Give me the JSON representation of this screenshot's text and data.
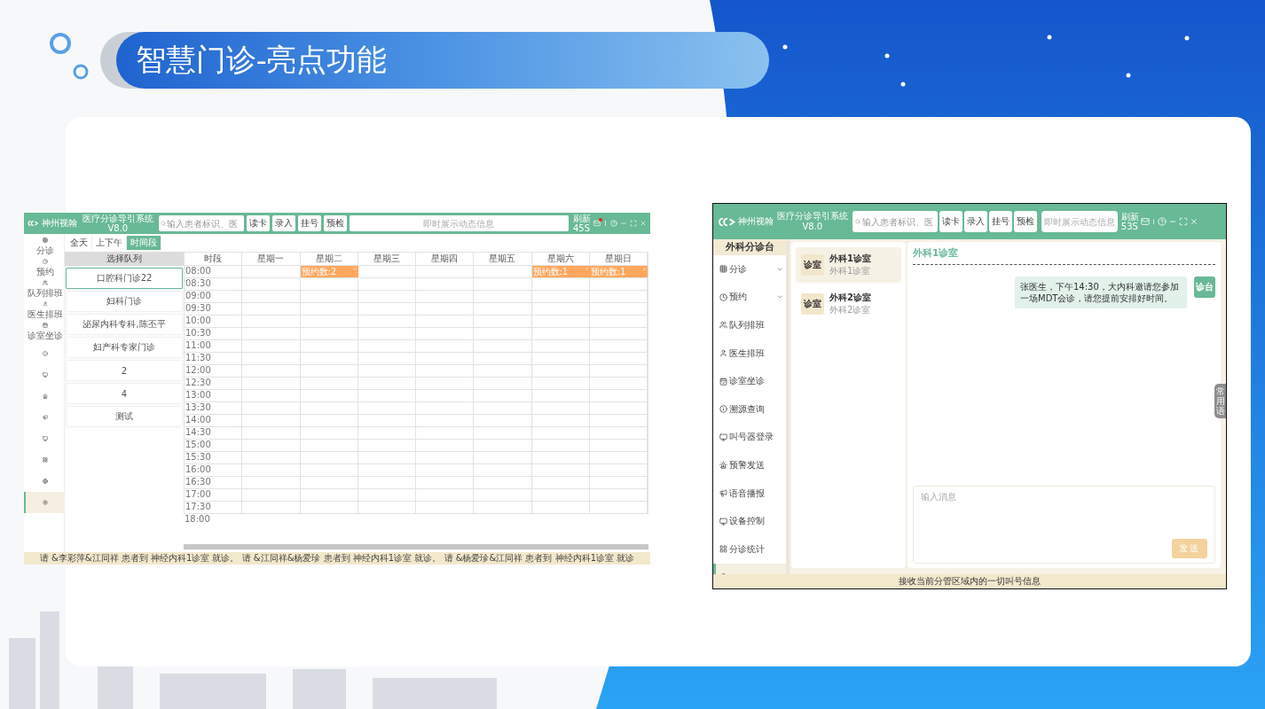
{
  "slide": {
    "title": "智慧门诊-亮点功能"
  },
  "schedule_app": {
    "brand": "神州视翰",
    "system_name": "医疗分诊导引系统",
    "version": "V8.0",
    "search": {
      "placeholder": "输入患者标识、医"
    },
    "toolbar_buttons": [
      "读卡",
      "录入",
      "挂号",
      "预检"
    ],
    "ticker": {
      "placeholder": "即时展示动态信息"
    },
    "refresh": {
      "label": "刷新",
      "countdown": "45S"
    },
    "unread": true,
    "sidebar": [
      {
        "label": "分诊",
        "selected": false
      },
      {
        "label": "预约",
        "selected": false
      },
      {
        "label": "队列排班",
        "selected": false
      },
      {
        "label": "医生排班",
        "selected": false
      },
      {
        "label": "诊室坐诊",
        "selected": false
      },
      {
        "selected": false
      },
      {
        "selected": false
      },
      {
        "selected": false
      },
      {
        "selected": false
      },
      {
        "selected": false
      },
      {
        "selected": false
      },
      {
        "selected": false
      },
      {
        "selected": true
      }
    ],
    "view_tabs": [
      {
        "label": "全天",
        "selected": false
      },
      {
        "label": "上下午",
        "selected": false
      },
      {
        "label": "时间段",
        "selected": true
      }
    ],
    "queue_panel": {
      "title": "选择队列",
      "items": [
        {
          "label": "口腔科门诊22",
          "selected": true
        },
        {
          "label": "妇科门诊",
          "selected": false
        },
        {
          "label": "泌尿内科专科,陈丕平",
          "selected": false
        },
        {
          "label": "妇产科专家门诊",
          "selected": false
        },
        {
          "label": "2",
          "selected": false
        },
        {
          "label": "4",
          "selected": false
        },
        {
          "label": "测试",
          "selected": false
        }
      ]
    },
    "calendar": {
      "columns": [
        {
          "label": "时段"
        },
        {
          "label": "星期一"
        },
        {
          "label": "星期二",
          "event": {
            "label": "预约数:2"
          }
        },
        {
          "label": "星期三"
        },
        {
          "label": "星期四"
        },
        {
          "label": "星期五"
        },
        {
          "label": "星期六",
          "event": {
            "label": "预约数:1"
          }
        },
        {
          "label": "星期日",
          "event": {
            "label": "预约数:1"
          }
        }
      ],
      "times": [
        "08:00",
        "08:30",
        "09:00",
        "09:30",
        "10:00",
        "10:30",
        "11:00",
        "11:30",
        "12:00",
        "12:30",
        "13:00",
        "13:30",
        "14:00",
        "14:30",
        "15:00",
        "15:30",
        "16:00",
        "16:30",
        "17:00",
        "17:30",
        "18:00"
      ]
    },
    "status_bar": "请 &李彩萍&江同祥 患者到 神经内科1诊室 就诊。 请 &江同祥&杨爱珍 患者到 神经内科1诊室 就诊。 请 &杨爱珍&江同祥 患者到 神经内科1诊室 就诊"
  },
  "triage_app": {
    "brand": "神州视翰",
    "system_name": "医疗分诊导引系统",
    "version": "V8.0",
    "search": {
      "placeholder": "输入患者标识、医"
    },
    "toolbar_buttons": [
      "读卡",
      "录入",
      "挂号",
      "预检"
    ],
    "ticker": {
      "placeholder": "即时展示动态信息"
    },
    "refresh": {
      "label": "刷新",
      "countdown": "53S"
    },
    "unread": false,
    "sidebar_title": "外科分诊台",
    "sidebar": [
      {
        "label": "分诊",
        "expandable": true,
        "selected": false
      },
      {
        "label": "预约",
        "expandable": true,
        "selected": false
      },
      {
        "label": "队列排班",
        "expandable": false,
        "selected": false
      },
      {
        "label": "医生排班",
        "expandable": false,
        "selected": false
      },
      {
        "label": "诊室坐诊",
        "expandable": false,
        "selected": false
      },
      {
        "label": "溯源查询",
        "expandable": false,
        "selected": false
      },
      {
        "label": "叫号器登录",
        "expandable": false,
        "selected": false
      },
      {
        "label": "预警发送",
        "expandable": false,
        "selected": false
      },
      {
        "label": "语音播报",
        "expandable": false,
        "selected": false
      },
      {
        "label": "设备控制",
        "expandable": false,
        "selected": false
      },
      {
        "label": "分诊统计",
        "expandable": false,
        "selected": false
      },
      {
        "expandable": false,
        "selected": true
      }
    ],
    "rooms": [
      {
        "badge": "诊室",
        "name": "外科1诊室",
        "subtitle": "外科1诊室",
        "selected": true
      },
      {
        "badge": "诊室",
        "name": "外科2诊室",
        "subtitle": "外科2诊室",
        "selected": false
      }
    ],
    "chat": {
      "title": "外科1诊室",
      "messages": [
        {
          "text": "张医生，下午14:30，大内科邀请您参加一场MDT会诊，请您提前安排好时间。",
          "sender": "诊台"
        }
      ],
      "side_tab": "常用语",
      "compose": {
        "placeholder": "输入消息"
      },
      "send_button": "发送"
    },
    "status_bar": "接收当前分管区域内的一切叫号信息"
  }
}
